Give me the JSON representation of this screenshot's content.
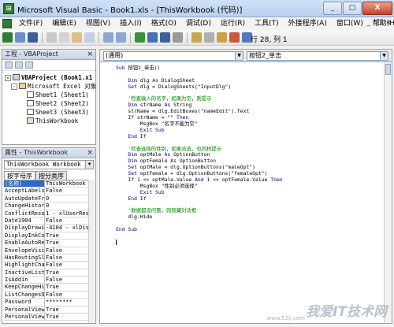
{
  "window": {
    "title": "Microsoft Visual Basic - Book1.xls - [ThisWorkbook (代码)]",
    "buttons": [
      "_",
      "□",
      "X"
    ]
  },
  "menubar": {
    "items": [
      "文件(F)",
      "编辑(E)",
      "视图(V)",
      "插入(I)",
      "格式(O)",
      "调试(D)",
      "运行(R)",
      "工具(T)",
      "外接程序(A)",
      "窗口(W)",
      "帮助(H)"
    ],
    "mdi_buttons": [
      "_",
      "□",
      "x"
    ]
  },
  "toolbar": {
    "cursor_position": "行 28, 列 1",
    "icons": [
      "excel-icon",
      "insert-module-icon",
      "save-icon",
      "cut-icon",
      "copy-icon",
      "paste-icon",
      "find-icon",
      "undo-icon",
      "redo-icon",
      "run-icon",
      "break-icon",
      "reset-icon",
      "design-mode-icon",
      "project-explorer-icon",
      "properties-icon",
      "object-browser-icon",
      "toolbox-icon",
      "help-icon"
    ]
  },
  "project_panel": {
    "title": "工程 - VBAProject",
    "tree": [
      {
        "label": "VBAProject (Book1.x1",
        "level": 0,
        "bold": true,
        "expander": "-"
      },
      {
        "label": "Microsoft Excel 对象",
        "level": 1,
        "bold": false,
        "expander": "-"
      },
      {
        "label": "Sheet1 (Sheet1)",
        "level": 2,
        "bold": false,
        "expander": ""
      },
      {
        "label": "Sheet2 (Sheet2)",
        "level": 2,
        "bold": false,
        "expander": ""
      },
      {
        "label": "Sheet3 (Sheet3)",
        "level": 2,
        "bold": false,
        "expander": ""
      },
      {
        "label": "ThisWorkbook",
        "level": 2,
        "bold": false,
        "expander": ""
      }
    ]
  },
  "props_panel": {
    "title": "属性 - ThisWorkbook",
    "object_select": "ThisWorkbook Workbook",
    "tabs": [
      "按字母序",
      "按分类序"
    ],
    "rows": [
      {
        "name": "(名称)",
        "value": "ThisWorkbook",
        "selected": true
      },
      {
        "name": "AcceptLabelsIn",
        "value": "False"
      },
      {
        "name": "AutoUpdateFre",
        "value": "0"
      },
      {
        "name": "ChangeHistoryD",
        "value": "0"
      },
      {
        "name": "ConflictResol",
        "value": "1 - xlUserRes"
      },
      {
        "name": "Date1904",
        "value": "False"
      },
      {
        "name": "DisplayDrawin",
        "value": "-4104 - xlDis"
      },
      {
        "name": "DisplayInkCom",
        "value": "True"
      },
      {
        "name": "EnableAutoRec",
        "value": "True"
      },
      {
        "name": "EnvelopeVisib",
        "value": "False"
      },
      {
        "name": "HasRoutingSli",
        "value": "False"
      },
      {
        "name": "HighlightChan",
        "value": "False"
      },
      {
        "name": "InactiveListB",
        "value": "True"
      },
      {
        "name": "IsAddin",
        "value": "False"
      },
      {
        "name": "KeepChangeHis",
        "value": "True"
      },
      {
        "name": "ListChangesOn",
        "value": "False"
      },
      {
        "name": "Password",
        "value": "********"
      },
      {
        "name": "PersonalViewL",
        "value": "True"
      },
      {
        "name": "PersonalViewP",
        "value": "True"
      }
    ]
  },
  "code_window": {
    "object_combo": "(通用)",
    "procedure_combo": "按钮2_单击",
    "lines": [
      {
        "text": "Sub 按钮2_单击()",
        "type": "code"
      },
      {
        "text": "",
        "type": "code"
      },
      {
        "text": "    Dim dlg As DialogSheet",
        "type": "code"
      },
      {
        "text": "    Set dlg = DialogSheets(\"InputDlg\")",
        "type": "code"
      },
      {
        "text": "",
        "type": "code"
      },
      {
        "text": "    '检查输入的名字，如果为空，则提示",
        "type": "comment"
      },
      {
        "text": "    Dim strName As String",
        "type": "code"
      },
      {
        "text": "    strName = dlg.EditBoxes(\"nameEdit\").Text",
        "type": "code"
      },
      {
        "text": "    If strName = \"\" Then",
        "type": "code"
      },
      {
        "text": "        MsgBox \"名字不能为空\"",
        "type": "code"
      },
      {
        "text": "        Exit Sub",
        "type": "code"
      },
      {
        "text": "    End If",
        "type": "code"
      },
      {
        "text": "",
        "type": "code"
      },
      {
        "text": "    '检查选择的性别，如果没选，也同样提示",
        "type": "comment"
      },
      {
        "text": "    Dim optMale As OptionButton",
        "type": "code"
      },
      {
        "text": "    Dim optFemale As OptionButton",
        "type": "code"
      },
      {
        "text": "    Set optMale = dlg.OptionButtons(\"maleOpt\")",
        "type": "code"
      },
      {
        "text": "    Set optFemale = dlg.OptionButtons(\"femaleOpt\")",
        "type": "code"
      },
      {
        "text": "    If 1 <> optMale.Value And 1 <> optFemale.Value Then",
        "type": "code"
      },
      {
        "text": "        MsgBox \"性别必须选择\"",
        "type": "code"
      },
      {
        "text": "        Exit Sub",
        "type": "code"
      },
      {
        "text": "    End If",
        "type": "code"
      },
      {
        "text": "",
        "type": "code"
      },
      {
        "text": "    '数据都没问题，则隐藏对话框",
        "type": "comment"
      },
      {
        "text": "    dlg.Hide",
        "type": "code"
      },
      {
        "text": "",
        "type": "code"
      },
      {
        "text": "End Sub",
        "type": "code"
      },
      {
        "text": "",
        "type": "code"
      }
    ]
  },
  "watermark": {
    "main": "我爱IT技术网",
    "sub": "www.52ij.com"
  }
}
